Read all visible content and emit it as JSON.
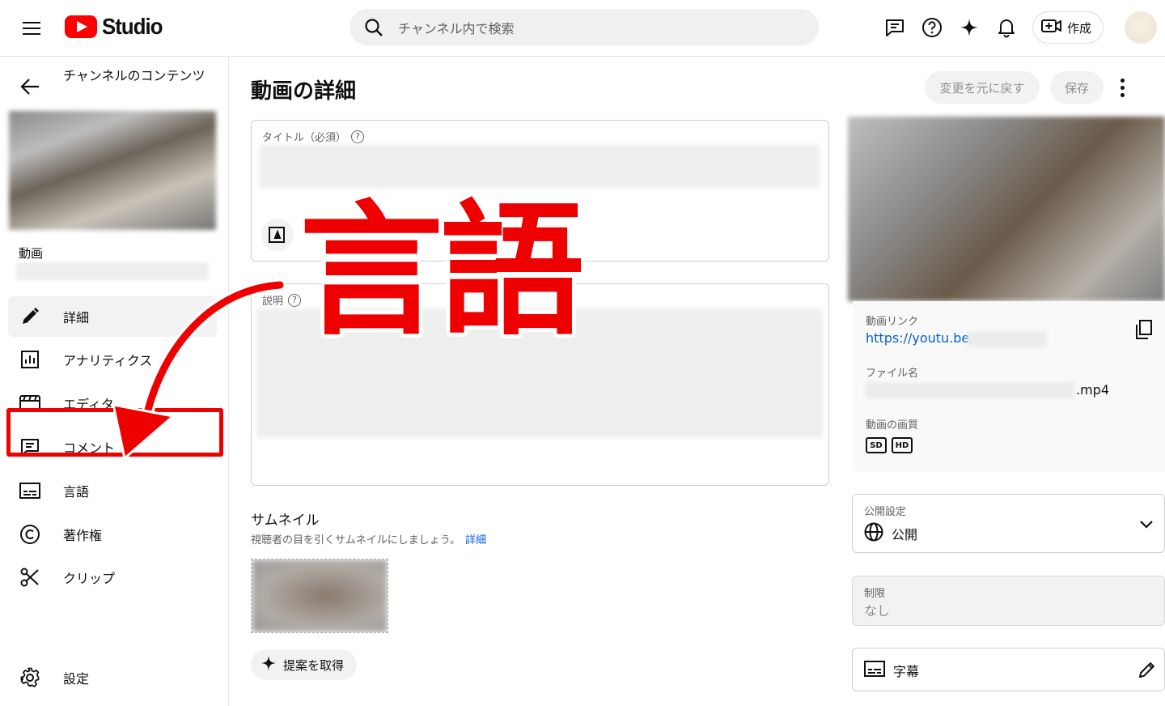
{
  "header": {
    "brand": "Studio",
    "search_placeholder": "チャンネル内で検索",
    "create_label": "作成"
  },
  "sidebar": {
    "back_title": "チャンネルのコンテンツ",
    "video_label": "動画",
    "items": [
      {
        "label": "詳細",
        "icon": "pencil-icon"
      },
      {
        "label": "アナリティクス",
        "icon": "analytics-icon"
      },
      {
        "label": "エディタ",
        "icon": "editor-icon"
      },
      {
        "label": "コメント",
        "icon": "comment-icon"
      },
      {
        "label": "言語",
        "icon": "subtitles-icon"
      },
      {
        "label": "著作権",
        "icon": "copyright-icon"
      },
      {
        "label": "クリップ",
        "icon": "scissors-icon"
      }
    ],
    "settings_label": "設定"
  },
  "main": {
    "page_title": "動画の詳細",
    "undo_label": "変更を元に戻す",
    "save_label": "保存",
    "title_field_label": "タイトル（必須）",
    "description_label": "説明",
    "thumbnail": {
      "title": "サムネイル",
      "desc": "視聴者の目を引くサムネイルにしましょう。",
      "link": "詳細"
    },
    "suggest_label": "提案を取得"
  },
  "overlay": {
    "text": "言語",
    "color": "#ee0000"
  },
  "right": {
    "video_link_label": "動画リンク",
    "video_link": "https://youtu.be/",
    "filename_label": "ファイル名",
    "filename_ext": ".mp4",
    "quality_label": "動画の画質",
    "quality_badges": [
      "SD",
      "HD"
    ],
    "visibility_label": "公開設定",
    "visibility_value": "公開",
    "restriction_label": "制限",
    "restriction_value": "なし",
    "subtitles_label": "字幕"
  },
  "colors": {
    "link": "#065fd4",
    "brand_red": "#ff0000",
    "annotation_red": "#ee0000"
  }
}
